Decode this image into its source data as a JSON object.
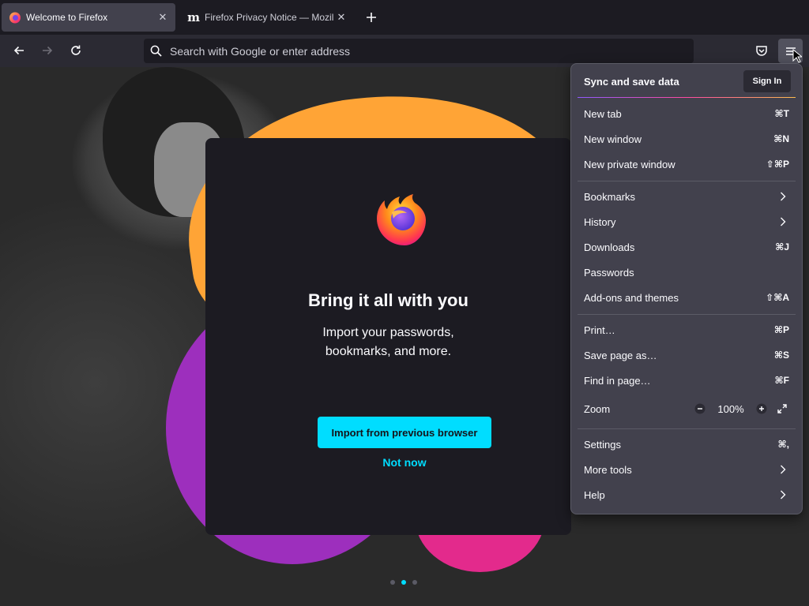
{
  "tabs": [
    {
      "title": "Welcome to Firefox",
      "active": true,
      "icon": "firefox-icon"
    },
    {
      "title": "Firefox Privacy Notice — Mozilla",
      "active": false,
      "icon": "mozilla-m-icon"
    }
  ],
  "mozilla_logo_letter": "m",
  "navbar": {
    "url_placeholder": "Search with Google or enter address"
  },
  "welcome": {
    "title": "Bring it all with you",
    "subtitle_line1": "Import your passwords,",
    "subtitle_line2": "bookmarks, and more.",
    "primary_button": "Import from previous browser",
    "secondary_link": "Not now",
    "steps_total": 3,
    "step_current": 2
  },
  "appmenu": {
    "sync_label": "Sync and save data",
    "signin_label": "Sign In",
    "items": [
      {
        "label": "New tab",
        "key": "⌘T"
      },
      {
        "label": "New window",
        "key": "⌘N"
      },
      {
        "label": "New private window",
        "key": "⇧⌘P"
      },
      {
        "label": "Bookmarks",
        "key": ""
      },
      {
        "label": "History",
        "key": ""
      },
      {
        "label": "Downloads",
        "key": "⌘J"
      },
      {
        "label": "Passwords",
        "key": ""
      },
      {
        "label": "Add-ons and themes",
        "key": "⇧⌘A"
      },
      {
        "label": "Print…",
        "key": "⌘P"
      },
      {
        "label": "Save page as…",
        "key": "⌘S"
      },
      {
        "label": "Find in page…",
        "key": "⌘F"
      },
      {
        "label": "Zoom",
        "key": ""
      },
      {
        "label": "Settings",
        "key": "⌘,"
      },
      {
        "label": "More tools",
        "key": ""
      },
      {
        "label": "Help",
        "key": ""
      }
    ],
    "zoom_value": "100%",
    "zoom_minus": "−",
    "zoom_plus": "+"
  },
  "colors": {
    "accent": "#00ddff",
    "toolbar": "#2b2a33",
    "menu_bg": "#42414d"
  }
}
